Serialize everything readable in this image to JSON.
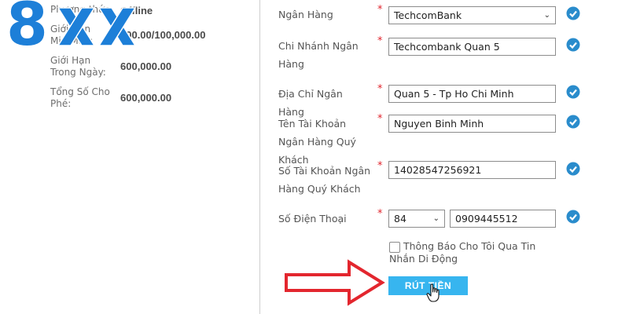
{
  "left_info": {
    "method_label": "Phương thức:",
    "method_value": "Offline",
    "minmax_label": "Giới Hạn Min/Max:",
    "minmax_value": "100.00/100,000.00",
    "daily_label": "Giới Hạn Trong Ngày:",
    "daily_value": "600,000.00",
    "fee_label": "Tổng Số Cho Phé:",
    "fee_value": "600,000.00"
  },
  "logo": {
    "digit": "8",
    "letters": "XX"
  },
  "form": {
    "bank": {
      "label": "Ngân Hàng",
      "value": "TechcomBank"
    },
    "branch": {
      "label": "Chi Nhánh Ngân Hàng",
      "value": "Techcombank Quan 5"
    },
    "address": {
      "label": "Địa Chỉ Ngân Hàng",
      "value": "Quan 5 - Tp Ho Chi Minh"
    },
    "account_name": {
      "label": "Tên Tài Khoản Ngân Hàng Quý Khách",
      "value": "Nguyen Binh Minh"
    },
    "account_number": {
      "label": "Số Tài Khoản Ngân Hàng Quý Khách",
      "value": "14028547256921"
    },
    "phone": {
      "label": "Số Điện Thoại",
      "country_code": "84",
      "value": "0909445512"
    },
    "required_mark": "*",
    "sms_checkbox": {
      "label": "Thông Báo Cho Tôi Qua Tin Nhắn Di Động",
      "checked": false
    },
    "submit_label": "RÚT TIỀN"
  },
  "icons": {
    "valid": "check-circle-icon",
    "select": "chevron-down-icon",
    "pointer": "hand-cursor-icon",
    "callout": "red-arrow"
  },
  "colors": {
    "logo_blue": "#1d7fd8",
    "submit_bg": "#37b5ef",
    "check_blue": "#2a8ccc",
    "required_red": "#e0242c",
    "arrow_red": "#e3262e"
  }
}
